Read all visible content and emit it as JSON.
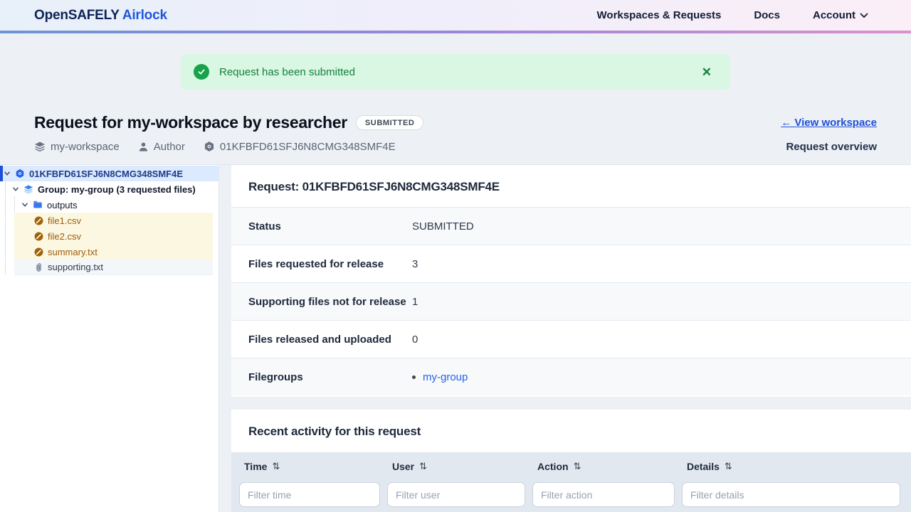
{
  "colors": {
    "accent_blue": "#2057dc",
    "link_blue": "#1f4fd8",
    "success_green": "#17a34a",
    "success_bg": "#d9f7e3",
    "selected_tree_bg": "#dbeafe",
    "pending_file_amber": "#9c5c0f",
    "pending_file_bg": "#fcf7e1",
    "table_head_bg": "#e2e8f0"
  },
  "header": {
    "logo_primary": "OpenSAFELY",
    "logo_secondary": "Airlock",
    "nav": [
      {
        "label": "Workspaces & Requests"
      },
      {
        "label": "Docs"
      },
      {
        "label": "Account"
      }
    ]
  },
  "notification": {
    "message": "Request has been submitted",
    "close_glyph": "✕"
  },
  "title": {
    "heading": "Request for my-workspace by researcher",
    "status_badge": "SUBMITTED",
    "back_link": "← View workspace",
    "overview_label": "Request overview",
    "meta": {
      "workspace": "my-workspace",
      "author": "Author",
      "request_id": "01KFBFD61SFJ6N8CMG348SMF4E"
    }
  },
  "tree": {
    "items": [
      {
        "label": "01KFBFD61SFJ6N8CMG348SMF4E",
        "icon": "request-cube-icon",
        "selected": true
      },
      {
        "label": "Group: my-group (3 requested files)",
        "icon": "layers-icon"
      },
      {
        "label": "outputs",
        "icon": "folder-icon"
      },
      {
        "label": "file1.csv",
        "icon": "file-pending-icon"
      },
      {
        "label": "file2.csv",
        "icon": "file-pending-icon"
      },
      {
        "label": "summary.txt",
        "icon": "file-pending-icon"
      },
      {
        "label": "supporting.txt",
        "icon": "paperclip-icon"
      }
    ]
  },
  "request_details": {
    "heading": "Request: 01KFBFD61SFJ6N8CMG348SMF4E",
    "rows": [
      {
        "label": "Status",
        "value": "SUBMITTED"
      },
      {
        "label": "Files requested for release",
        "value": "3"
      },
      {
        "label": "Supporting files not for release",
        "value": "1"
      },
      {
        "label": "Files released and uploaded",
        "value": "0"
      },
      {
        "label": "Filegroups",
        "value": "my-group"
      }
    ]
  },
  "activity": {
    "heading": "Recent activity for this request",
    "sort_icon": "⇅",
    "columns": [
      {
        "label": "Time",
        "filter_placeholder": "Filter time"
      },
      {
        "label": "User",
        "filter_placeholder": "Filter user"
      },
      {
        "label": "Action",
        "filter_placeholder": "Filter action"
      },
      {
        "label": "Details",
        "filter_placeholder": "Filter details"
      }
    ]
  }
}
